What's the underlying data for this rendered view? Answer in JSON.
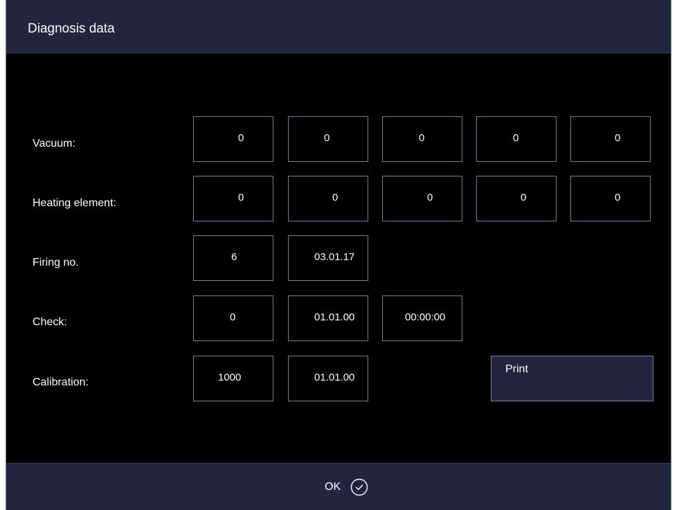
{
  "window": {
    "title": "Diagnosis data"
  },
  "rows": {
    "vacuum": {
      "label": "Vacuum:",
      "values": [
        "0",
        "0",
        "0",
        "0",
        "0"
      ]
    },
    "heating": {
      "label": "Heating element:",
      "values": [
        "0",
        "0",
        "0",
        "0",
        "0"
      ]
    },
    "firing": {
      "label": "Firing no.",
      "values": [
        "6",
        "03.01.17"
      ]
    },
    "check": {
      "label": "Check:",
      "values": [
        "0",
        "01.01.00",
        "00:00:00"
      ]
    },
    "calibration": {
      "label": "Calibration:",
      "values": [
        "1000",
        "01.01.00"
      ]
    }
  },
  "print_button": {
    "label": "Print"
  },
  "footer": {
    "ok_label": "OK",
    "ok_icon": "check-circle-icon"
  },
  "colors": {
    "background": "#000000",
    "bar": "#222440",
    "border": "#7a7d94",
    "text": "#ffffff"
  }
}
